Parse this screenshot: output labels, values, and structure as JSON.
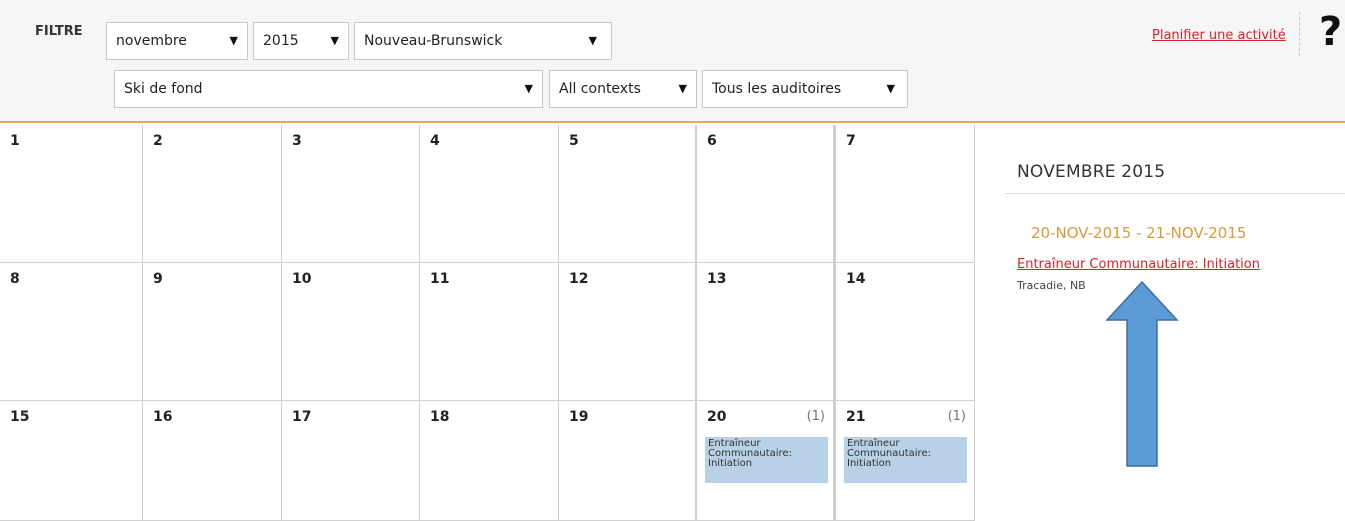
{
  "filter": {
    "label": "FILTRE",
    "month": "novembre",
    "year": "2015",
    "province": "Nouveau-Brunswick",
    "sport": "Ski de fond",
    "context": "All contexts",
    "audience": "Tous les auditoires"
  },
  "header": {
    "plan_link": "Planifier une activité",
    "help": "?"
  },
  "calendar": {
    "weeks": [
      [
        {
          "day": "1"
        },
        {
          "day": "2"
        },
        {
          "day": "3"
        },
        {
          "day": "4"
        },
        {
          "day": "5"
        },
        {
          "day": "6"
        },
        {
          "day": "7"
        }
      ],
      [
        {
          "day": "8"
        },
        {
          "day": "9"
        },
        {
          "day": "10"
        },
        {
          "day": "11"
        },
        {
          "day": "12"
        },
        {
          "day": "13"
        },
        {
          "day": "14"
        }
      ],
      [
        {
          "day": "15"
        },
        {
          "day": "16"
        },
        {
          "day": "17"
        },
        {
          "day": "18"
        },
        {
          "day": "19"
        },
        {
          "day": "20",
          "count": "(1)",
          "event": "Entraîneur Communautaire: Initiation"
        },
        {
          "day": "21",
          "count": "(1)",
          "event": "Entraîneur Communautaire: Initiation"
        }
      ]
    ]
  },
  "side": {
    "title": "NOVEMBRE 2015",
    "date_range": "20-NOV-2015 - 21-NOV-2015",
    "event_title": "Entraîneur Communautaire: Initiation",
    "location": "Tracadie, NB"
  },
  "colors": {
    "accent": "#e3a84a",
    "link": "#d6222a",
    "event_bg": "#b8d1e6",
    "date_range": "#d99a3c",
    "arrow": "#5b9bd5"
  },
  "icons": {
    "dropdown": "▼",
    "annotation": "up-arrow"
  }
}
